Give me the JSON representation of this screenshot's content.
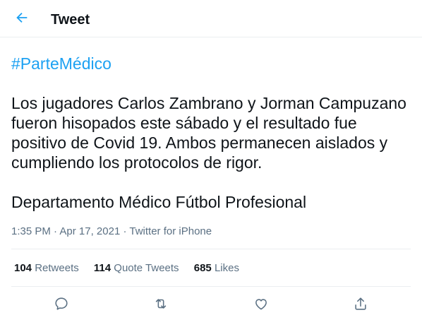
{
  "header": {
    "title": "Tweet",
    "back_icon": "arrow-left-icon"
  },
  "tweet": {
    "hashtag": "#ParteMédico",
    "body": "Los jugadores Carlos Zambrano y Jorman Campuzano fueron hisopados este sábado y el resultado fue positivo de Covid 19. Ambos permanecen aislados y cumpliendo los protocolos de rigor.",
    "signature": "Departamento Médico Fútbol Profesional",
    "time": "1:35 PM",
    "separator": "·",
    "date": "Apr 17, 2021",
    "source": "Twitter for iPhone"
  },
  "stats": {
    "retweets_count": "104",
    "retweets_label": "Retweets",
    "quotes_count": "114",
    "quotes_label": "Quote Tweets",
    "likes_count": "685",
    "likes_label": "Likes"
  },
  "actions": {
    "reply_icon": "reply-icon",
    "retweet_icon": "retweet-icon",
    "like_icon": "heart-icon",
    "share_icon": "share-icon"
  },
  "colors": {
    "accent": "#1da1f2",
    "text": "#0f1419",
    "secondary": "#5b7083",
    "divider": "#ebeef0"
  }
}
